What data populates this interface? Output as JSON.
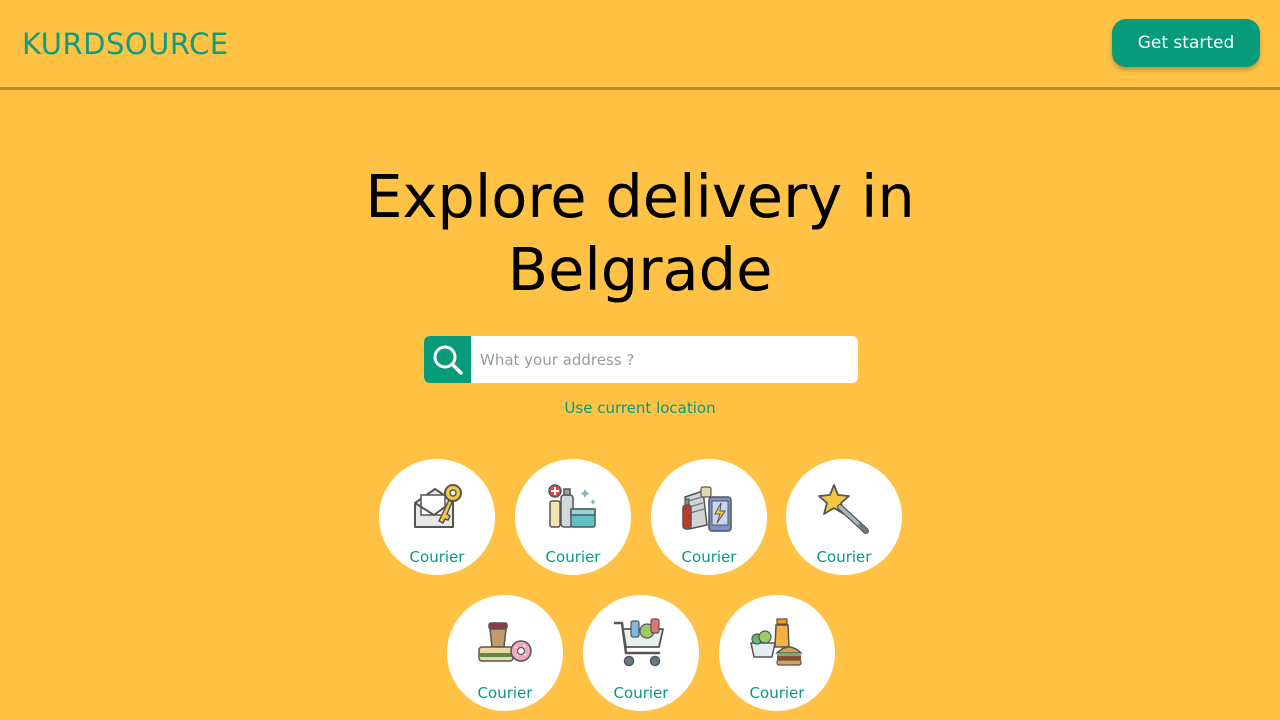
{
  "header": {
    "logo": "KURDSOURCE",
    "cta_label": "Get started"
  },
  "hero": {
    "title_line1": "Explore delivery in",
    "title_line2": "Belgrade"
  },
  "search": {
    "placeholder": "What your address ?",
    "icon": "search-icon"
  },
  "use_location_label": "Use current location",
  "categories": [
    {
      "label": "Courier",
      "icon": "envelope-key-icon"
    },
    {
      "label": "Courier",
      "icon": "pharmacy-products-icon"
    },
    {
      "label": "Courier",
      "icon": "electronics-icon"
    },
    {
      "label": "Courier",
      "icon": "magic-wand-icon"
    },
    {
      "label": "Courier",
      "icon": "snacks-icon"
    },
    {
      "label": "Courier",
      "icon": "shopping-cart-icon"
    },
    {
      "label": "Courier",
      "icon": "food-drink-icon"
    }
  ],
  "colors": {
    "background": "#ffc245",
    "accent": "#079b7c",
    "divider": "#b98a2c"
  }
}
